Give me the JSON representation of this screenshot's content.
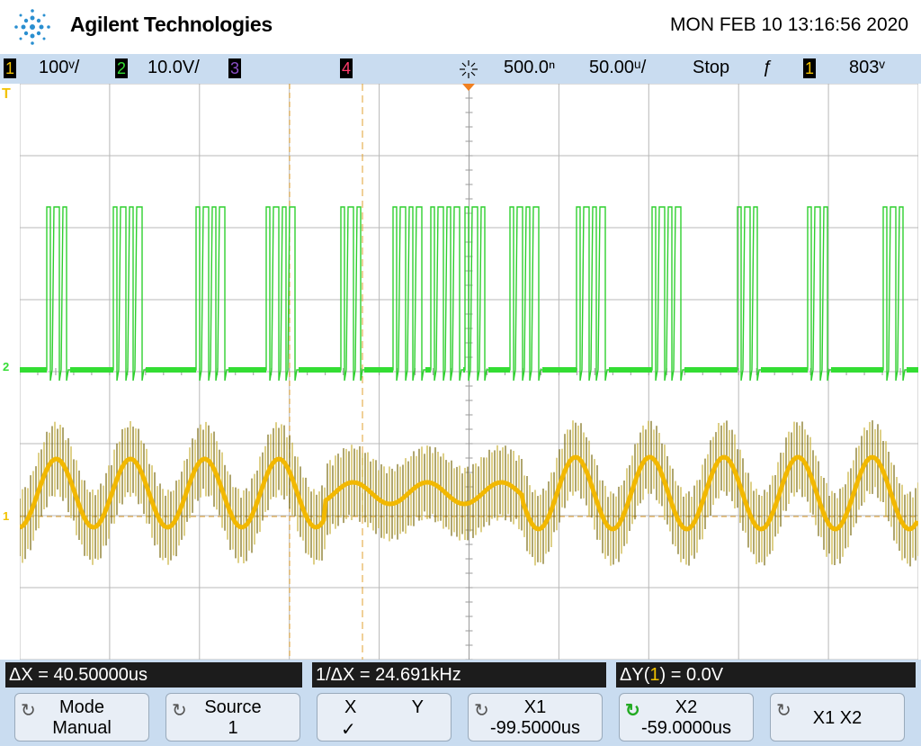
{
  "header": {
    "brand": "Agilent Technologies",
    "datetime": "MON FEB 10 13:16:56 2020"
  },
  "status_bar": {
    "ch1_num": "1",
    "ch1_scale": "100ᵛ/",
    "ch2_num": "2",
    "ch2_scale": "10.0V/",
    "ch3_num": "3",
    "ch4_num": "4",
    "time_delay": "500.0ⁿ",
    "time_scale": "50.00ᵘ/",
    "run_state": "Stop",
    "trigger_slope": "ƒ",
    "trigger_source": "1",
    "trigger_level": "803ᵛ",
    "colors": {
      "ch1": "#f2c200",
      "ch2": "#33dd33",
      "ch3": "#8a4fc6",
      "ch4": "#ff3b6b"
    }
  },
  "screen": {
    "ch2_marker": "2",
    "ch1_marker": "1",
    "trigger_marker": "T"
  },
  "measurements": {
    "delta_x": "ΔX = 40.50000us",
    "inv_delta_x": "1/ΔX = 24.691kHz",
    "delta_y_prefix": "ΔY(",
    "delta_y_channel": "1",
    "delta_y_suffix": ") = 0.0V"
  },
  "softkeys": {
    "mode_label": "Mode",
    "mode_value": "Manual",
    "source_label": "Source",
    "source_value": "1",
    "x_label": "X",
    "y_label": "Y",
    "x_check": "✓",
    "x1_label": "X1",
    "x1_value": "-99.5000us",
    "x2_label": "X2",
    "x2_value": "-59.0000us",
    "x1x2_label": "X1 X2"
  }
}
